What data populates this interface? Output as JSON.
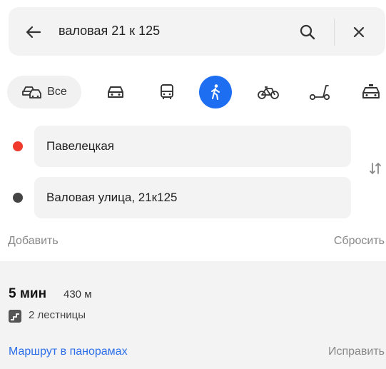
{
  "search": {
    "query": "валовая 21 к 125",
    "back_icon": "arrow-left-icon",
    "search_icon": "search-icon",
    "close_icon": "close-icon"
  },
  "transport_modes": {
    "all_label": "Все",
    "items": [
      {
        "name": "all",
        "icon": "all-transport-icon",
        "selected": false
      },
      {
        "name": "car",
        "icon": "car-icon",
        "selected": false
      },
      {
        "name": "bus",
        "icon": "bus-icon",
        "selected": false
      },
      {
        "name": "pedestrian",
        "icon": "pedestrian-icon",
        "selected": true
      },
      {
        "name": "bicycle",
        "icon": "bicycle-icon",
        "selected": false
      },
      {
        "name": "scooter",
        "icon": "scooter-icon",
        "selected": false
      },
      {
        "name": "taxi",
        "icon": "taxi-icon",
        "selected": false
      }
    ]
  },
  "points": {
    "from": "Павелецкая",
    "to": "Валовая улица, 21к125",
    "from_color": "#f03a2e",
    "to_color": "#444444"
  },
  "actions": {
    "add": "Добавить",
    "reset": "Сбросить"
  },
  "route": {
    "time": "5 мин",
    "distance": "430 м",
    "stairs": "2 лестницы",
    "panorama_link": "Маршрут в панорамах",
    "fix_link": "Исправить"
  },
  "colors": {
    "accent": "#1e6ef2",
    "link": "#2b6ee8"
  }
}
